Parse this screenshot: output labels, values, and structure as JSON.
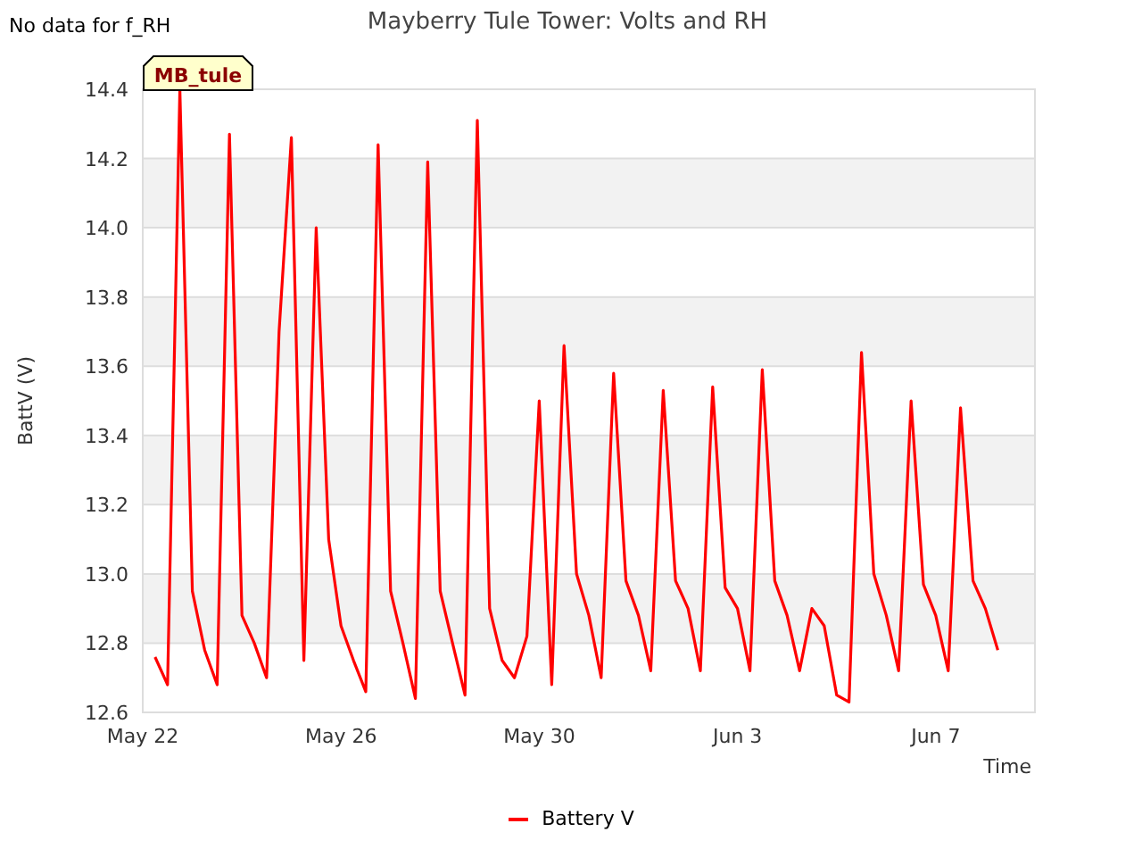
{
  "notice": "No data for f_RH",
  "station_tag": "MB_tule",
  "chart_data": {
    "type": "line",
    "title": "Mayberry Tule Tower: Volts and RH",
    "xlabel": "Time",
    "ylabel": "BattV (V)",
    "categories": [
      "May 22",
      null,
      null,
      null,
      null,
      null,
      null,
      null,
      null,
      null,
      null,
      null,
      null,
      null,
      null,
      null,
      "May 26",
      null,
      null,
      null,
      null,
      null,
      null,
      null,
      null,
      null,
      null,
      null,
      null,
      null,
      null,
      null,
      "May 30",
      null,
      null,
      null,
      null,
      null,
      null,
      null,
      null,
      null,
      null,
      null,
      null,
      null,
      null,
      null,
      "Jun 3",
      null,
      null,
      null,
      null,
      null,
      null,
      null,
      null,
      null,
      null,
      null,
      null,
      null,
      null,
      null,
      "Jun 7",
      null,
      null,
      null,
      null,
      null
    ],
    "series": [
      {
        "name": "Battery V",
        "color": "#ff0000",
        "values": [
          null,
          12.76,
          12.68,
          14.4,
          12.95,
          12.78,
          12.68,
          14.27,
          12.88,
          12.8,
          12.7,
          13.7,
          14.26,
          12.75,
          14.0,
          13.1,
          12.85,
          12.75,
          12.66,
          14.24,
          12.95,
          12.8,
          12.64,
          14.19,
          12.95,
          12.8,
          12.65,
          14.31,
          12.9,
          12.75,
          12.7,
          12.82,
          13.5,
          12.68,
          13.66,
          13.0,
          12.88,
          12.7,
          13.58,
          12.98,
          12.88,
          12.72,
          13.53,
          12.98,
          12.9,
          12.72,
          13.54,
          12.96,
          12.9,
          12.72,
          13.59,
          12.98,
          12.88,
          12.72,
          12.9,
          12.85,
          12.65,
          12.63,
          13.64,
          13.0,
          12.88,
          12.72,
          13.5,
          12.97,
          12.88,
          12.72,
          13.48,
          12.98,
          12.9,
          12.78
        ]
      }
    ],
    "grid": true,
    "bands": [
      {
        "axis": "y",
        "from": 12.8,
        "to": 13.0
      },
      {
        "axis": "y",
        "from": 13.2,
        "to": 13.4
      },
      {
        "axis": "y",
        "from": 13.6,
        "to": 13.8
      },
      {
        "axis": "y",
        "from": 14.0,
        "to": 14.2
      }
    ],
    "ylim": [
      12.6,
      14.4
    ],
    "yticks": [
      {
        "value": 12.6,
        "label": "12.6"
      },
      {
        "value": 12.8,
        "label": "12.8"
      },
      {
        "value": 13,
        "label": "13.0"
      },
      {
        "value": 13.2,
        "label": "13.2"
      },
      {
        "value": 13.4,
        "label": "13.4"
      },
      {
        "value": 13.6,
        "label": "13.6"
      },
      {
        "value": 13.8,
        "label": "13.8"
      },
      {
        "value": 14,
        "label": "14.0"
      },
      {
        "value": 14.2,
        "label": "14.2"
      },
      {
        "value": 14.4,
        "label": "14.4"
      }
    ]
  }
}
